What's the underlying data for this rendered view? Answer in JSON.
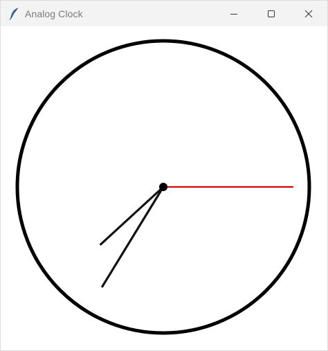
{
  "window": {
    "title": "Analog Clock",
    "app_icon": "feather-icon",
    "controls": {
      "minimize": "minimize-icon",
      "maximize": "maximize-icon",
      "close": "close-icon"
    }
  },
  "clock": {
    "face_color": "#000000",
    "hand_color": "#111111",
    "second_hand_color": "#e00000",
    "time": {
      "hours": 7,
      "minutes": 35,
      "seconds": 15
    }
  }
}
